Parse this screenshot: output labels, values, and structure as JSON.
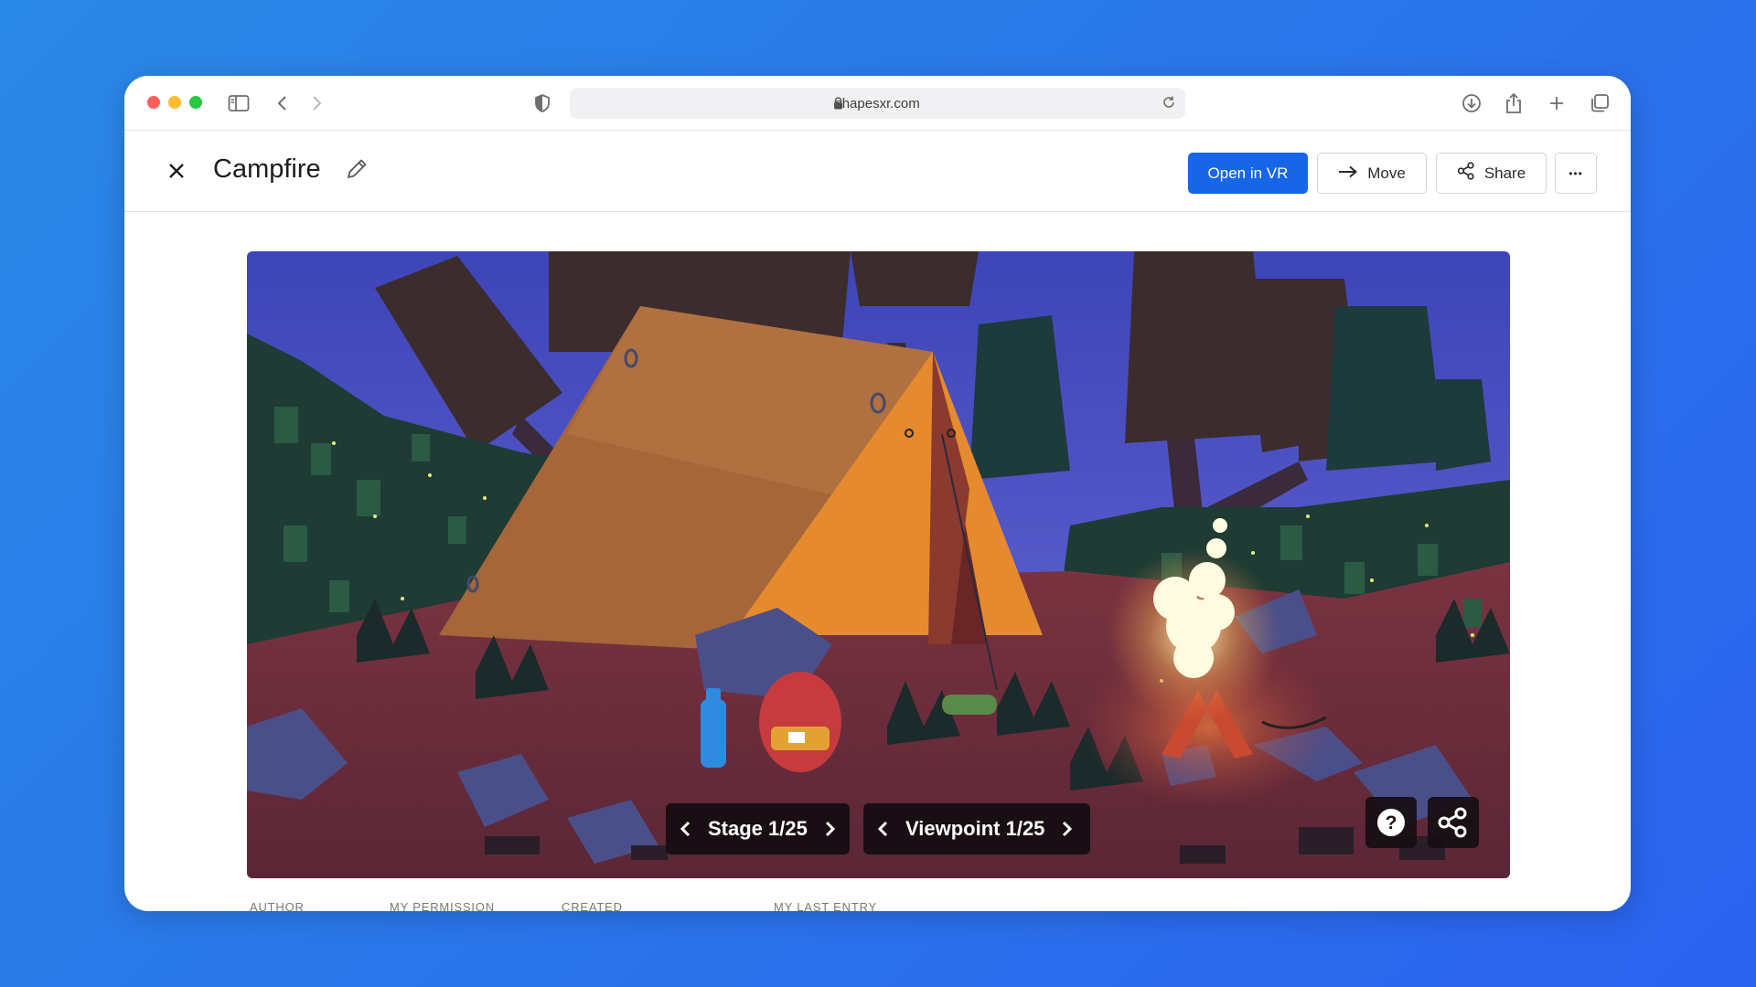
{
  "browser": {
    "url": "shapesxr.com"
  },
  "header": {
    "title": "Campfire",
    "open_vr_label": "Open in VR",
    "move_label": "Move",
    "share_label": "Share",
    "more_label": "•••"
  },
  "preview": {
    "stage_label": "Stage 1/25",
    "viewpoint_label": "Viewpoint 1/25",
    "help_symbol": "?"
  },
  "meta": {
    "labels": [
      "AUTHOR",
      "MY PERMISSION",
      "CREATED",
      "MY LAST ENTRY"
    ]
  },
  "colors": {
    "background": "#2a74ea",
    "primary_button": "#1766e8",
    "tent": "#e58a2e",
    "sky": "#4b52c8",
    "ground": "#8a3a3c"
  }
}
